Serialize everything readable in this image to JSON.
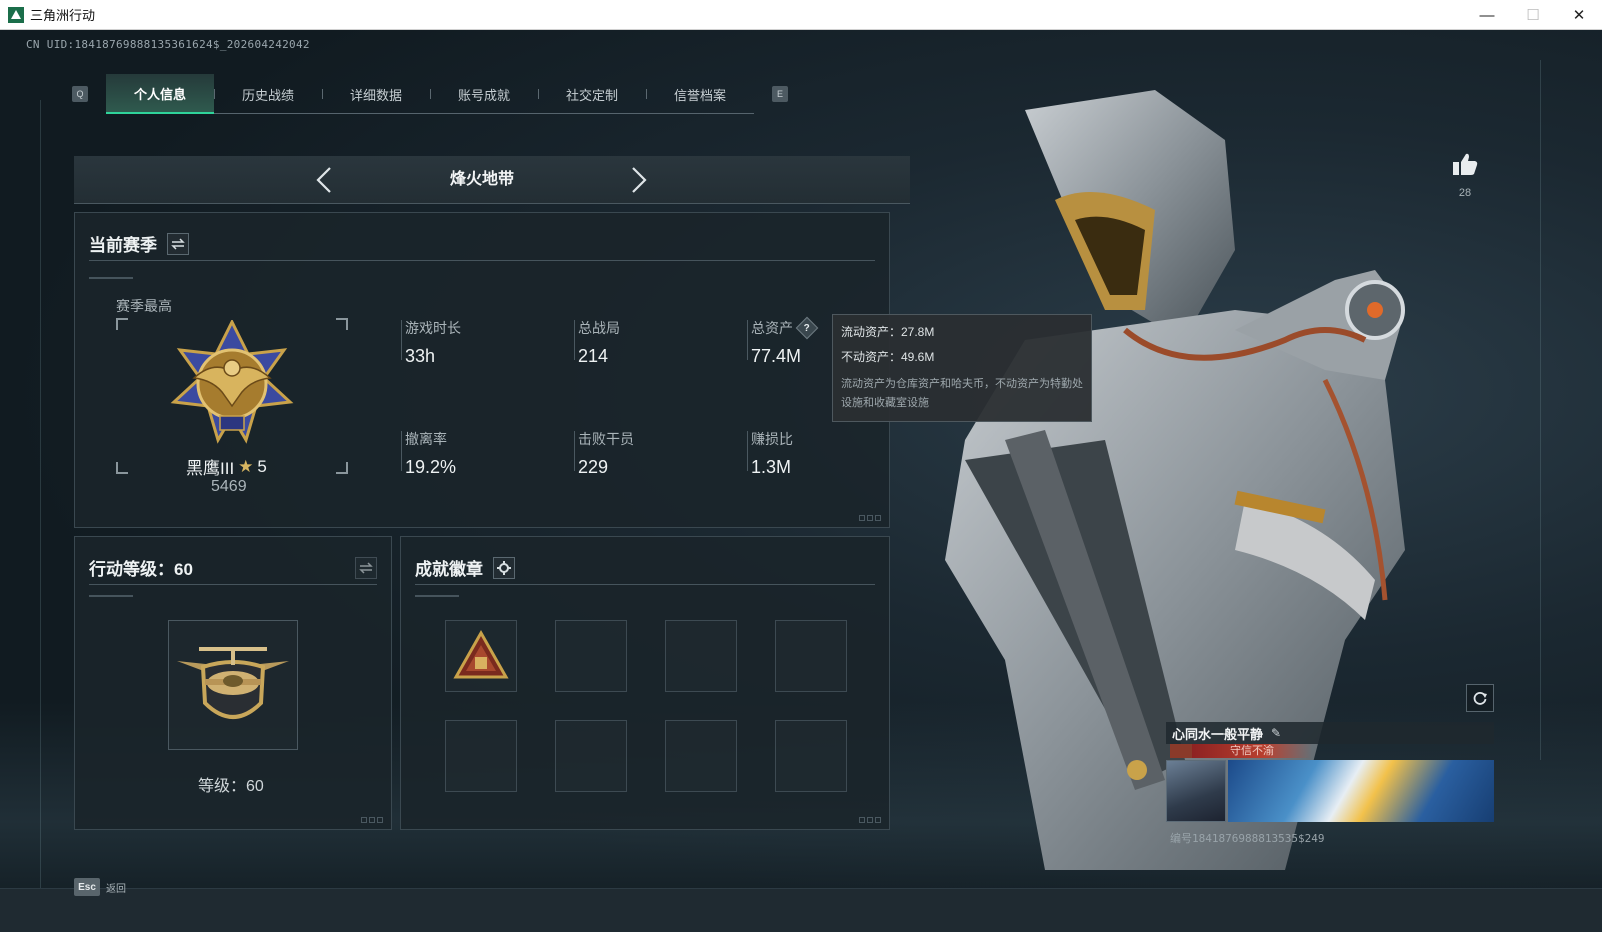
{
  "window": {
    "title": "三角洲行动",
    "minimize": "—",
    "maximize": "☐",
    "close": "✕"
  },
  "uid_text": "CN UID:18418769888135361624$_202604242042",
  "tabs": {
    "prev_key": "Q",
    "next_key": "E",
    "items": [
      {
        "label": "个人信息",
        "active": true
      },
      {
        "label": "历史战绩",
        "active": false
      },
      {
        "label": "详细数据",
        "active": false
      },
      {
        "label": "账号成就",
        "active": false
      },
      {
        "label": "社交定制",
        "active": false
      },
      {
        "label": "信誉档案",
        "active": false
      }
    ]
  },
  "mode": {
    "title": "烽火地带"
  },
  "season": {
    "title": "当前赛季",
    "best_label": "赛季最高",
    "rank_name": "黑鹰III",
    "rank_star": "★",
    "rank_stars": "5",
    "rank_score": "5469",
    "stats": [
      {
        "label": "游戏时长",
        "value": "33h"
      },
      {
        "label": "总战局",
        "value": "214"
      },
      {
        "label": "总资产",
        "value": "77.4M",
        "help": "?"
      },
      {
        "label": "撤离率",
        "value": "19.2%"
      },
      {
        "label": "击败干员",
        "value": "229"
      },
      {
        "label": "赚损比",
        "value": "1.3M"
      }
    ]
  },
  "tooltip": {
    "liquid": "流动资产：27.8M",
    "fixed": "不动资产：49.6M",
    "desc": "流动资产为仓库资产和哈夫币，不动资产为特勤处设施和收藏室设施"
  },
  "level": {
    "title": "行动等级：60",
    "caption": "等级：60"
  },
  "achievements": {
    "title": "成就徽章"
  },
  "likes": {
    "count": "28"
  },
  "namecard": {
    "name": "心同水一般平静",
    "title": "守信不渝",
    "id_text": "编号1841876988813535$249"
  },
  "footer": {
    "esc_key": "Esc",
    "back_label": "返回"
  },
  "colors": {
    "accent": "#2fd49a",
    "gold": "#d7b661",
    "title_red": "#b8402f"
  }
}
